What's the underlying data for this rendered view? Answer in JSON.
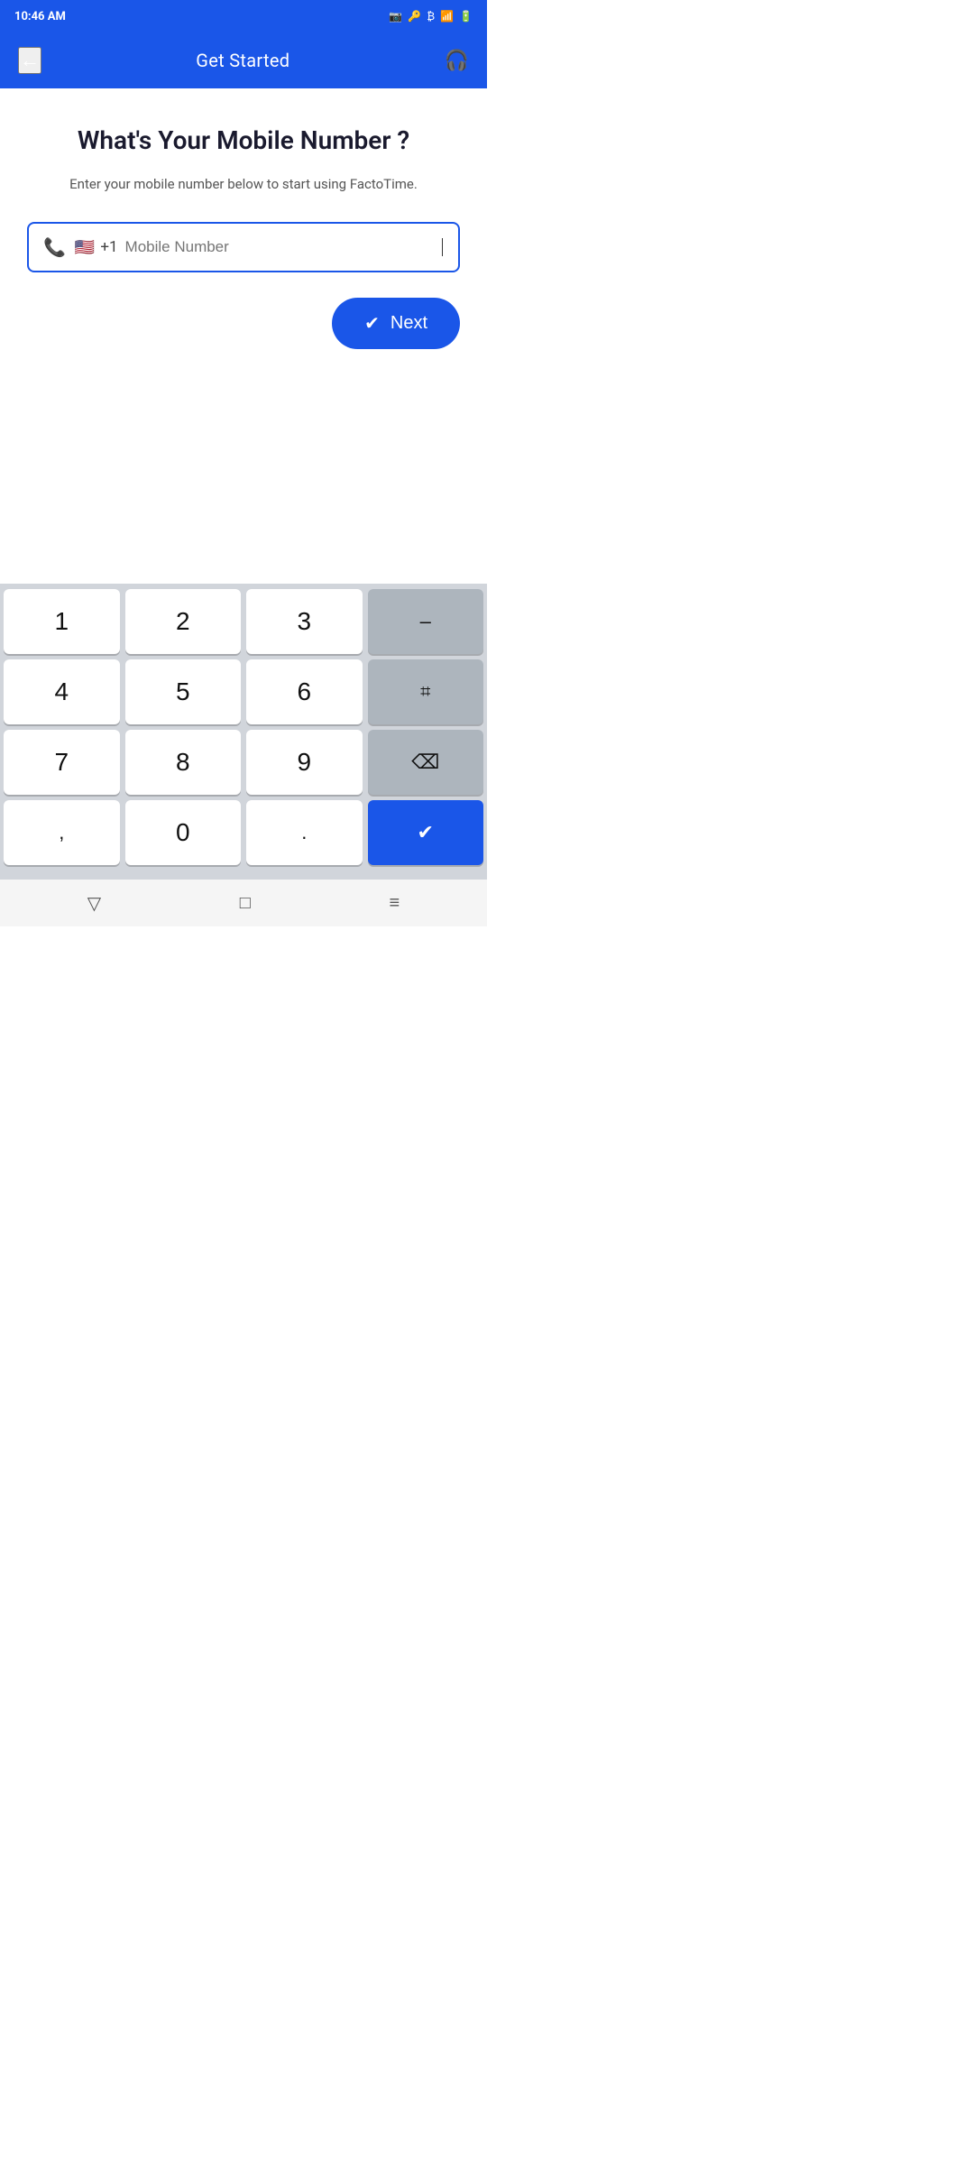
{
  "statusBar": {
    "time": "10:46 AM"
  },
  "header": {
    "title": "Get Started",
    "backIcon": "←",
    "headsetIcon": "🎧"
  },
  "main": {
    "heading": "What's Your Mobile Number ?",
    "subtitle": "Enter your mobile number below to start using FactoTime.",
    "phoneInput": {
      "placeholder": "Mobile Number",
      "countryCode": "+1",
      "flagEmoji": "🇺🇸"
    },
    "nextButton": "Next"
  },
  "keyboard": {
    "rows": [
      [
        "1",
        "2",
        "3",
        "–"
      ],
      [
        "4",
        "5",
        "6",
        "⌗"
      ],
      [
        "7",
        "8",
        "9",
        "⌫"
      ],
      [
        ",",
        "0",
        ".",
        "✓"
      ]
    ]
  },
  "navBar": {
    "backIcon": "▽",
    "homeIcon": "□",
    "menuIcon": "≡"
  }
}
